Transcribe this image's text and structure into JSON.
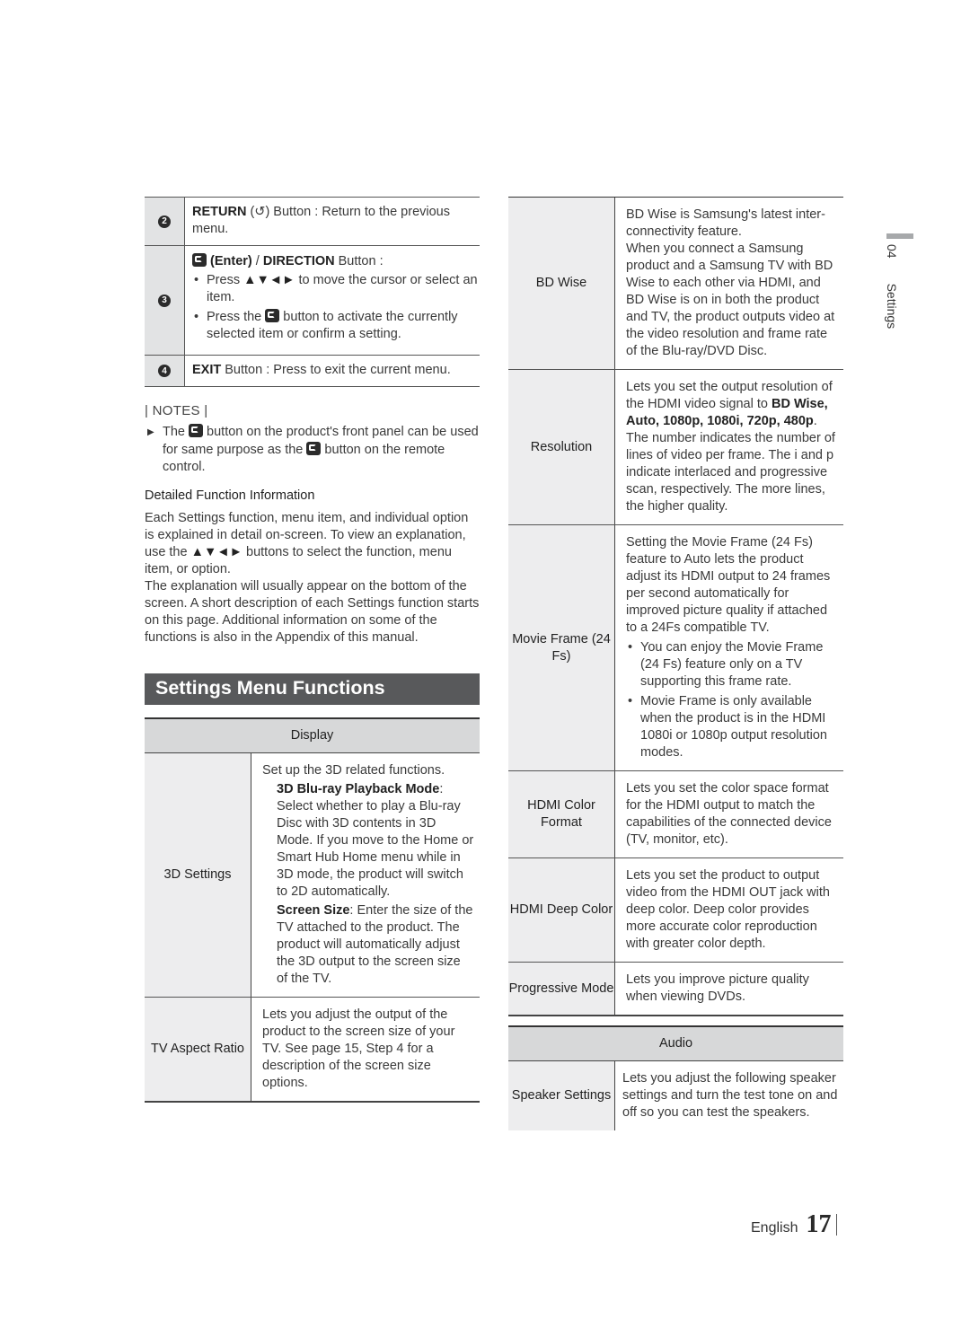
{
  "buttons": [
    {
      "num": "2",
      "bold": "RETURN",
      "icon": "return-icon",
      "rest": " Button : Return to the previous menu."
    },
    {
      "num": "3",
      "bold_a": "(Enter)",
      "sep": " / ",
      "bold_b": "DIRECTION",
      "rest": " Button :",
      "bullets": [
        {
          "pre": "Press ",
          "arrows": "▲▼◄►",
          "post": " to move the cursor or select an item."
        },
        {
          "pre": "Press the ",
          "post": " button to activate the currently selected item or confirm a setting."
        }
      ]
    },
    {
      "num": "4",
      "bold": "EXIT",
      "rest": " Button : Press to exit the current menu."
    }
  ],
  "notes": {
    "title": "| NOTES |",
    "items": [
      {
        "pre": "The ",
        "mid": " button on the product's front panel can be used for same purpose as the ",
        "post": " button on the remote control."
      }
    ]
  },
  "detail": {
    "heading": "Detailed Function Information",
    "p1_pre": "Each Settings function, menu item, and individual option is explained in detail on-screen. To view an explanation, use the ",
    "arrows": "▲▼◄►",
    "p1_post": " buttons to select the function, menu item, or option.",
    "p2": "The explanation will usually appear on the bottom of the screen. A short description of each Settings function starts on this page. Additional information on some of the functions is also in the Appendix of this manual."
  },
  "section_title": "Settings Menu Functions",
  "display": {
    "header": "Display",
    "rows": [
      {
        "key": "3D Settings",
        "intro": "Set up the 3D related functions.",
        "sub1_bold": "3D Blu-ray Playback Mode",
        "sub1_text": ": Select whether to play a Blu-ray Disc with 3D contents in 3D Mode. If you move to the Home or Smart Hub Home menu while in 3D mode, the product will switch to 2D automatically.",
        "sub2_bold": "Screen Size",
        "sub2_text": ": Enter the size of the TV attached to the product. The product will automatically adjust the 3D output to the screen size of the TV."
      },
      {
        "key": "TV Aspect Ratio",
        "text": "Lets you adjust the output of the product to the screen size of your TV. See page 15, Step 4 for a description of the screen size options."
      }
    ],
    "right_rows": [
      {
        "key": "BD Wise",
        "text": "BD Wise is Samsung's latest inter-connectivity feature.",
        "text2": "When you connect a Samsung product and a Samsung TV with BD Wise to each other via HDMI, and BD Wise is on in both the product and TV, the product outputs video at the video resolution and frame rate of the Blu-ray/DVD Disc."
      },
      {
        "key": "Resolution",
        "pre": "Lets you set the output resolution of the HDMI video signal to ",
        "bold": "BD Wise, Auto, 1080p, 1080i, 720p, 480p",
        "post": ". The number indicates the number of lines of video per frame. The i and p indicate interlaced and progressive scan, respectively. The more lines, the higher quality."
      },
      {
        "key": "Movie Frame (24 Fs)",
        "text": "Setting the Movie Frame (24 Fs) feature to Auto lets the product adjust its HDMI output to 24 frames per second automatically for improved picture quality if attached to a 24Fs compatible TV.",
        "bullets": [
          "You can enjoy the Movie Frame (24 Fs) feature only on a TV supporting this frame rate.",
          "Movie Frame is only available when the product is in the HDMI 1080i or 1080p output resolution modes."
        ]
      },
      {
        "key": "HDMI Color Format",
        "text": "Lets you set the color space format for the HDMI output to match the capabilities of the connected device (TV, monitor, etc)."
      },
      {
        "key": "HDMI Deep Color",
        "text": "Lets you set the product to output video from the HDMI OUT jack with deep color. Deep color provides more accurate color reproduction with greater color depth."
      },
      {
        "key": "Progressive Mode",
        "text": "Lets you improve picture quality when viewing DVDs."
      }
    ]
  },
  "audio": {
    "header": "Audio",
    "rows": [
      {
        "key": "Speaker Settings",
        "text": "Lets you adjust the following speaker settings and turn the test tone on and off so you can test the speakers."
      }
    ]
  },
  "side_tab": {
    "chapter": "04",
    "label": "Settings"
  },
  "footer": {
    "language": "English",
    "page": "17"
  }
}
